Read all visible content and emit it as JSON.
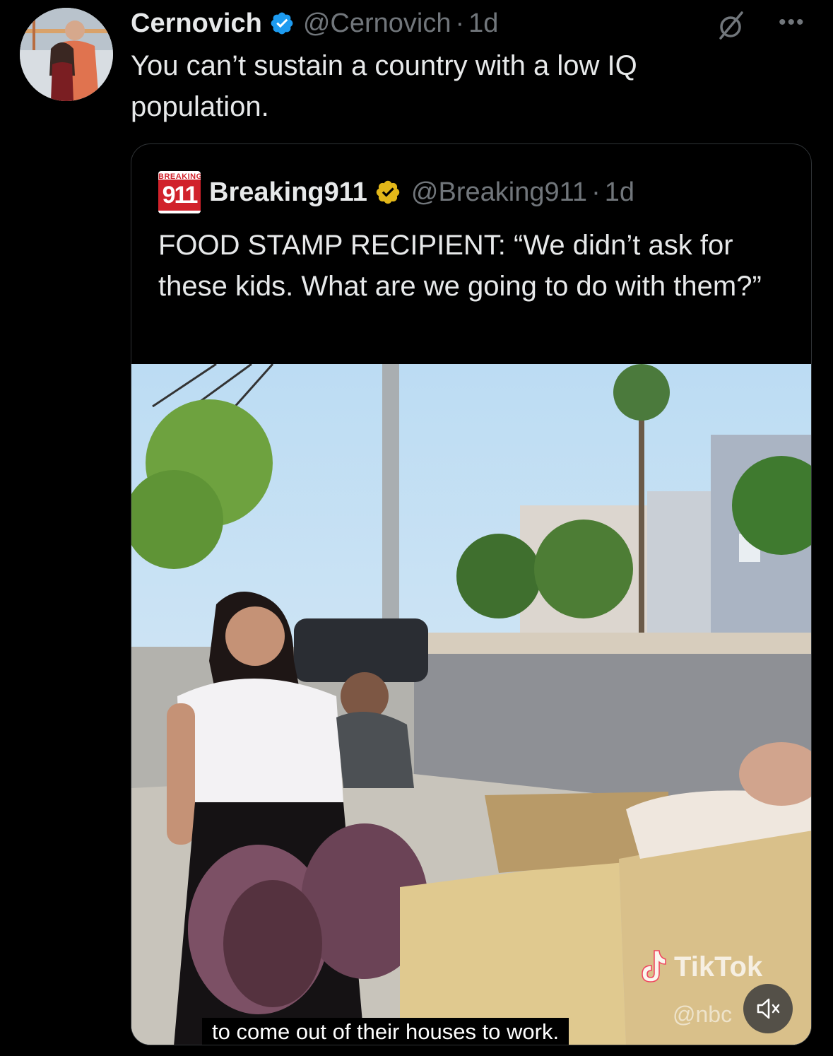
{
  "tweet": {
    "author_name": "Cernovich",
    "author_handle": "@Cernovich",
    "separator": "·",
    "time": "1d",
    "text": "You can’t sustain a country with a low IQ population.",
    "icons": [
      "verified-badge-icon",
      "grok-icon",
      "more-icon"
    ],
    "more_label": "•••"
  },
  "quote": {
    "avatar_top_text": "BREAKING",
    "avatar_number": "911",
    "author_name": "Breaking911",
    "author_handle": "@Breaking911",
    "separator": "·",
    "time": "1d",
    "text": "FOOD STAMP RECIPIENT: “We didn’t ask for these kids. What are we going to do with them?”",
    "icons": [
      "gold-verified-badge-icon"
    ]
  },
  "media": {
    "caption": "to come out of their houses to work.",
    "watermark": "TikTok",
    "watermark_user": "@nbc",
    "icons": [
      "tiktok-icon",
      "mute-icon"
    ]
  },
  "colors": {
    "background": "#000000",
    "text": "#e7e9ea",
    "secondary": "#71767b",
    "verified_blue": "#1d9bf0",
    "verified_gold": "#e2b719",
    "border": "#2f3336"
  }
}
